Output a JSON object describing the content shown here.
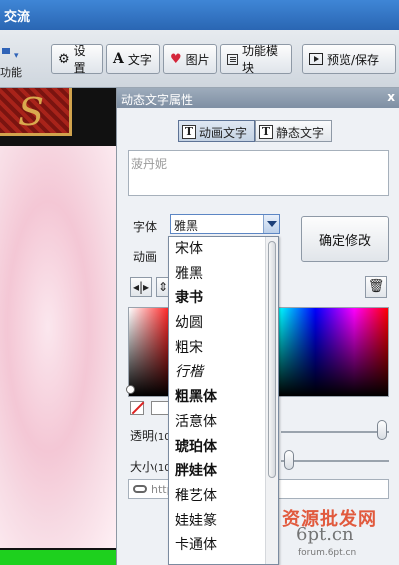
{
  "window": {
    "title": "交流"
  },
  "toolbar": {
    "left_label": "功能",
    "buttons": [
      {
        "label": "设置",
        "icon": "gear-icon"
      },
      {
        "label": "文字",
        "icon": "text-A-icon"
      },
      {
        "label": "图片",
        "icon": "heart-icon"
      },
      {
        "label": "功能模块",
        "icon": "module-icon"
      },
      {
        "label": "预览/保存",
        "icon": "play-icon"
      }
    ]
  },
  "panel": {
    "title": "动态文字属性",
    "close": "x",
    "modes": [
      {
        "label": "动画文字",
        "active": true
      },
      {
        "label": "静态文字",
        "active": false
      }
    ],
    "text_value": "菠丹妮",
    "font_label": "字体",
    "font_selected": "雅黑",
    "animation_label": "动画",
    "confirm_button": "确定修改",
    "opacity_label": "透明",
    "opacity_value_partial": "(10",
    "size_label": "大小",
    "size_value_partial": "(10",
    "url_partial": "http",
    "accent_color": "#5c86c4"
  },
  "font_options": [
    "宋体",
    "雅黑",
    "隶书",
    "幼圆",
    "粗宋",
    "行楷",
    "粗黑体",
    "活意体",
    "琥珀体",
    "胖娃体",
    "稚艺体",
    "娃娃篆",
    "卡通体"
  ],
  "watermark": {
    "line1": "资源批发网",
    "line2": "6pt.cn",
    "line3": "forum.6pt.cn"
  }
}
